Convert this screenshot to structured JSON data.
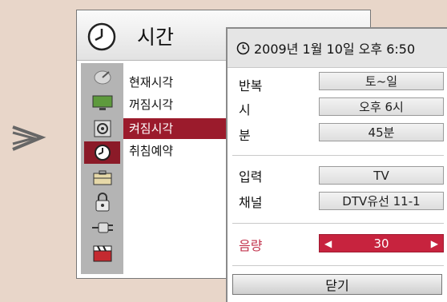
{
  "menu_title": "시간",
  "menu_items": [
    {
      "label": "현재시각",
      "active": false
    },
    {
      "label": "꺼짐시각",
      "active": false
    },
    {
      "label": "켜짐시각",
      "active": true
    },
    {
      "label": "취침예약",
      "active": false
    }
  ],
  "colons": [
    ":",
    ":",
    ":"
  ],
  "sidebar_icons": [
    "satellite-icon",
    "monitor-icon",
    "speaker-icon",
    "clock-icon",
    "toolbox-icon",
    "lock-icon",
    "plug-icon",
    "clapperboard-icon"
  ],
  "popup": {
    "datetime": "2009년 1월 10일 오후 6:50",
    "repeat_label": "반복",
    "repeat_value": "토~일",
    "hour_label": "시",
    "hour_value": "오후 6시",
    "minute_label": "분",
    "minute_value": "45분",
    "input_label": "입력",
    "input_value": "TV",
    "channel_label": "채널",
    "channel_value": "DTV유선 11-1",
    "volume_label": "음량",
    "volume_value": "30",
    "volume_left": "◀",
    "volume_right": "▶",
    "close_label": "닫기"
  },
  "colors": {
    "background": "#e8d6c9",
    "accent": "#c7233e",
    "menu_highlight": "#9b1b2c"
  }
}
